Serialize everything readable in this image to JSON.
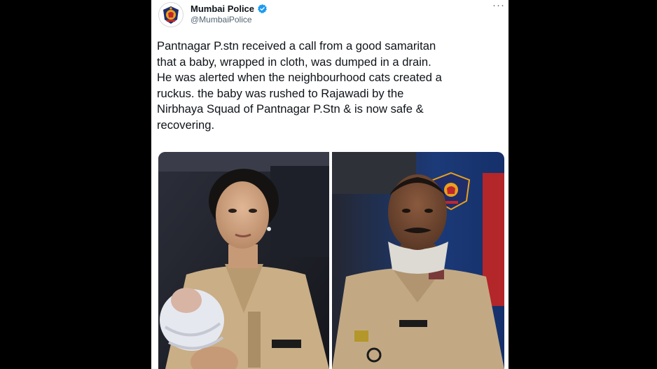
{
  "account": {
    "name": "Mumbai Police",
    "handle": "@MumbaiPolice",
    "avatar_icon": "police-crest-icon",
    "verified_icon": "verified-badge-icon",
    "verified_color": "#1d9bf0"
  },
  "tweet": {
    "text": "Pantnagar P.stn received a call from a good samaritan\nthat a baby, wrapped in cloth, was dumped in a drain.\nHe was alerted when the neighbourhood cats created a\nruckus. the baby was rushed to Rajawadi by the\nNirbhaya Squad of Pantnagar P.Stn & is now safe &\nrecovering."
  },
  "more_menu": {
    "label": "···",
    "icon": "more-horizontal-icon"
  },
  "media": {
    "photos": [
      {
        "subject": "female officer holding baby"
      },
      {
        "subject": "male officer"
      }
    ]
  },
  "colors": {
    "text": "#0f1419",
    "secondary": "#536471",
    "uniform": "#c9ae86",
    "background": "#000000"
  }
}
